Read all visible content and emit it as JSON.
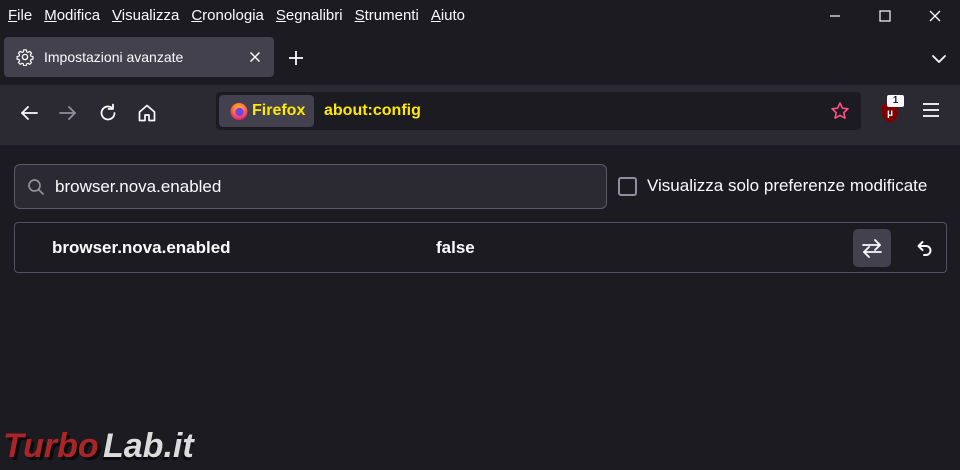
{
  "menubar": {
    "items": [
      {
        "label": "File",
        "mnemonic": "F",
        "rest": "ile"
      },
      {
        "label": "Modifica",
        "mnemonic": "M",
        "rest": "odifica"
      },
      {
        "label": "Visualizza",
        "mnemonic": "V",
        "rest": "isualizza"
      },
      {
        "label": "Cronologia",
        "mnemonic": "C",
        "rest": "ronologia"
      },
      {
        "label": "Segnalibri",
        "mnemonic": "S",
        "rest": "egnalibri"
      },
      {
        "label": "Strumenti",
        "mnemonic": "S",
        "rest": "trumenti"
      },
      {
        "label": "Aiuto",
        "mnemonic": "A",
        "rest": "iuto"
      }
    ]
  },
  "tab": {
    "title": "Impostazioni avanzate",
    "icon": "gear-icon"
  },
  "urlbar": {
    "identity_label": "Firefox",
    "url": "about:config"
  },
  "toolbar": {
    "ublock_badge": "1"
  },
  "config": {
    "search_value": "browser.nova.enabled",
    "modified_only_label": "Visualizza solo preferenze modificate",
    "modified_only_checked": false,
    "prefs": [
      {
        "name": "browser.nova.enabled",
        "value": "false"
      }
    ]
  },
  "watermark": {
    "text": "TurboLab.it"
  },
  "colors": {
    "background": "#1c1b22",
    "toolbar": "#2b2a33",
    "accent_yellow": "#ffe900",
    "star_pink": "#ff4f89"
  }
}
